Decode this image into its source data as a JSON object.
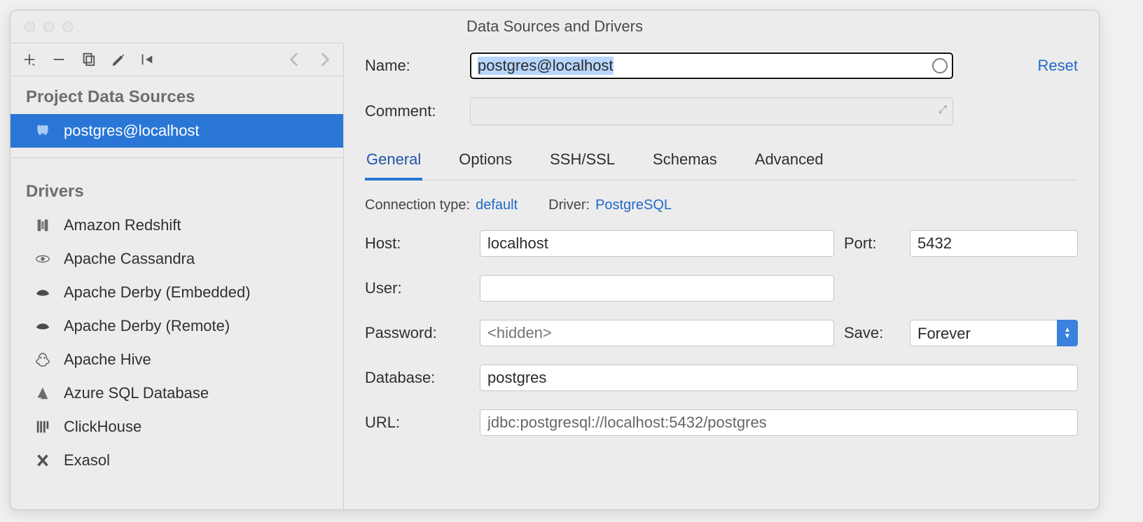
{
  "window": {
    "title": "Data Sources and Drivers"
  },
  "toolbar": {
    "add": "add",
    "remove": "remove",
    "duplicate": "duplicate",
    "settings": "settings",
    "import": "import",
    "back": "back",
    "forward": "forward"
  },
  "sidebar": {
    "section1": "Project Data Sources",
    "data_sources": [
      {
        "name": "postgres@localhost",
        "icon": "elephant",
        "selected": true
      }
    ],
    "section2": "Drivers",
    "drivers": [
      {
        "name": "Amazon Redshift",
        "icon": "redshift"
      },
      {
        "name": "Apache Cassandra",
        "icon": "cassandra"
      },
      {
        "name": "Apache Derby (Embedded)",
        "icon": "derby"
      },
      {
        "name": "Apache Derby (Remote)",
        "icon": "derby"
      },
      {
        "name": "Apache Hive",
        "icon": "hive"
      },
      {
        "name": "Azure SQL Database",
        "icon": "azure"
      },
      {
        "name": "ClickHouse",
        "icon": "clickhouse"
      },
      {
        "name": "Exasol",
        "icon": "exasol"
      }
    ]
  },
  "main": {
    "name_label": "Name:",
    "name_value": "postgres@localhost",
    "reset": "Reset",
    "comment_label": "Comment:",
    "tabs": [
      "General",
      "Options",
      "SSH/SSL",
      "Schemas",
      "Advanced"
    ],
    "active_tab": 0,
    "connection_type_label": "Connection type:",
    "connection_type_value": "default",
    "driver_label": "Driver:",
    "driver_value": "PostgreSQL",
    "host_label": "Host:",
    "host_value": "localhost",
    "port_label": "Port:",
    "port_value": "5432",
    "user_label": "User:",
    "user_value": "",
    "password_label": "Password:",
    "password_placeholder": "<hidden>",
    "save_label": "Save:",
    "save_value": "Forever",
    "database_label": "Database:",
    "database_value": "postgres",
    "url_label": "URL:",
    "url_value": "jdbc:postgresql://localhost:5432/postgres"
  }
}
